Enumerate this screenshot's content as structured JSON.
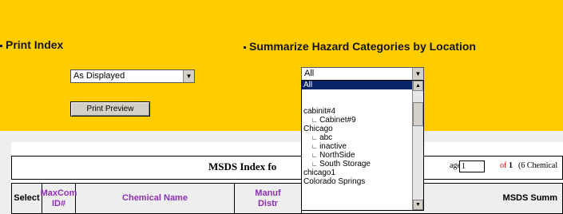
{
  "print_index": {
    "title": "Print Index",
    "format_select": "As Displayed",
    "print_preview_button": "Print Preview"
  },
  "summarize": {
    "title": "Summarize Hazard Categories by Location",
    "location_select": "All",
    "dropdown_options": [
      {
        "label": "All",
        "selected": true,
        "child": false
      },
      {
        "label": "",
        "selected": false,
        "child": false
      },
      {
        "label": "",
        "selected": false,
        "child": false
      },
      {
        "label": "cabinit#4",
        "selected": false,
        "child": false
      },
      {
        "label": "Cabinet#9",
        "selected": false,
        "child": true
      },
      {
        "label": "Chicago",
        "selected": false,
        "child": false
      },
      {
        "label": "abc",
        "selected": false,
        "child": true
      },
      {
        "label": "inactive",
        "selected": false,
        "child": true
      },
      {
        "label": "NorthSide",
        "selected": false,
        "child": true
      },
      {
        "label": "South Storage",
        "selected": false,
        "child": true
      },
      {
        "label": "chicago1",
        "selected": false,
        "child": false
      },
      {
        "label": "Colorado Springs",
        "selected": false,
        "child": false
      }
    ]
  },
  "index_table": {
    "title": "MSDS Index fo",
    "page_label": "age",
    "page_value": "1",
    "of_label": "of",
    "of_total": "1",
    "chemical_count": "(6 Chemical",
    "columns": [
      {
        "line1": "Select",
        "line2": "",
        "purple": false
      },
      {
        "line1": "MaxCom",
        "line2": "ID#",
        "purple": true
      },
      {
        "line1": "Chemical Name",
        "line2": "",
        "purple": true
      },
      {
        "line1": "Manuf",
        "line2": "Distr",
        "purple": true
      },
      {
        "line1": "MSDS Summ",
        "line2": "",
        "purple": false
      }
    ]
  },
  "colors": {
    "panel": "#ffcc00",
    "header_purple": "#8e2fb3",
    "selected_option": "#0a246a"
  }
}
